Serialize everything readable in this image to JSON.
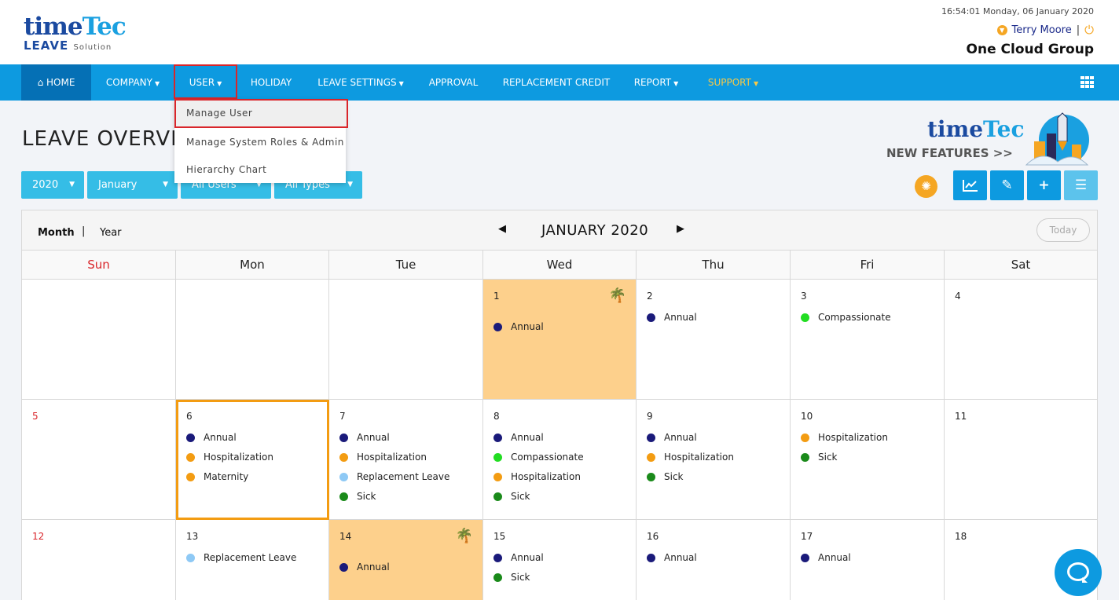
{
  "header": {
    "logo_main": "time",
    "logo_tec": "Tec",
    "logo_leave": "LEAVE",
    "logo_solution": "Solution",
    "datetime": "16:54:01 Monday, 06 January 2020",
    "user_name": "Terry Moore",
    "separator": "|",
    "company": "One Cloud Group"
  },
  "nav": {
    "home": "HOME",
    "company": "COMPANY",
    "user": "USER",
    "holiday": "HOLIDAY",
    "leave_settings": "LEAVE SETTINGS",
    "approval": "APPROVAL",
    "replacement_credit": "REPLACEMENT CREDIT",
    "report": "REPORT",
    "support": "SUPPORT"
  },
  "user_menu": [
    {
      "label": "Manage User",
      "active": true
    },
    {
      "label": "Manage System Roles & Admin"
    },
    {
      "label": "Hierarchy Chart"
    }
  ],
  "page_title": "LEAVE OVERVIEW",
  "new_features": {
    "brand_time": "time",
    "brand_tec": "Tec",
    "text": "NEW FEATURES >>"
  },
  "filters": {
    "year": "2020",
    "month": "January",
    "users": "All Users",
    "types": "All Types"
  },
  "toolbar_icons": [
    "bulb-icon",
    "chart-icon",
    "attachment-icon",
    "plus-icon",
    "list-icon"
  ],
  "calendar": {
    "view_month": "Month",
    "view_separator": "|",
    "view_year": "Year",
    "title": "JANUARY 2020",
    "today_label": "Today",
    "weekdays": [
      "Sun",
      "Mon",
      "Tue",
      "Wed",
      "Thu",
      "Fri",
      "Sat"
    ],
    "week1": {
      "d1": {
        "num": "1",
        "ev": [
          "Annual"
        ]
      },
      "d2": {
        "num": "2",
        "ev": [
          "Annual"
        ]
      },
      "d3": {
        "num": "3",
        "ev": [
          "Compassionate"
        ]
      },
      "d4": {
        "num": "4"
      }
    },
    "week2": {
      "d5": {
        "num": "5"
      },
      "d6": {
        "num": "6",
        "ev": [
          "Annual",
          "Hospitalization",
          "Maternity"
        ]
      },
      "d7": {
        "num": "7",
        "ev": [
          "Annual",
          "Hospitalization",
          "Replacement Leave",
          "Sick"
        ]
      },
      "d8": {
        "num": "8",
        "ev": [
          "Annual",
          "Compassionate",
          "Hospitalization",
          "Sick"
        ]
      },
      "d9": {
        "num": "9",
        "ev": [
          "Annual",
          "Hospitalization",
          "Sick"
        ]
      },
      "d10": {
        "num": "10",
        "ev": [
          "Hospitalization",
          "Sick"
        ]
      },
      "d11": {
        "num": "11"
      }
    },
    "week3": {
      "d12": {
        "num": "12"
      },
      "d13": {
        "num": "13",
        "ev": [
          "Replacement Leave"
        ]
      },
      "d14": {
        "num": "14",
        "ev": [
          "Annual"
        ]
      },
      "d15": {
        "num": "15",
        "ev": [
          "Annual",
          "Sick"
        ]
      },
      "d16": {
        "num": "16",
        "ev": [
          "Annual"
        ]
      },
      "d17": {
        "num": "17",
        "ev": [
          "Annual"
        ]
      },
      "d18": {
        "num": "18"
      }
    },
    "leave_colors": {
      "Annual": "#1a1a7a",
      "Hospitalization": "#f39c12",
      "Maternity": "#f39c12",
      "Compassionate": "#22dd22",
      "Replacement Leave": "#8ec9f5",
      "Sick": "#1a8a1a"
    }
  }
}
